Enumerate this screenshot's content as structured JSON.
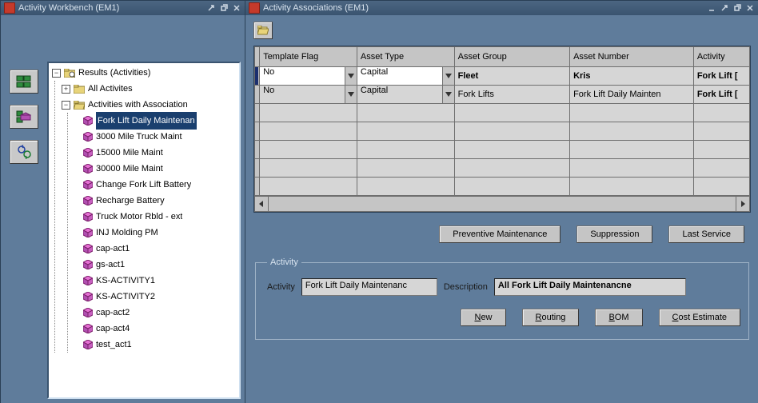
{
  "workbench": {
    "title": "Activity Workbench (EM1)",
    "tree_root": "Results (Activities)",
    "folder_all": "All Activites",
    "folder_assoc": "Activities with Association",
    "items": [
      "Fork Lift Daily Maintenan",
      "3000 Mile Truck Maint",
      "15000 Mile Maint",
      "30000 Mile Maint",
      "Change Fork Lift Battery",
      "Recharge Battery",
      "Truck Motor Rbld - ext",
      "INJ Molding PM",
      "cap-act1",
      "gs-act1",
      "KS-ACTIVITY1",
      "KS-ACTIVITY2",
      "cap-act2",
      "cap-act4",
      "test_act1"
    ]
  },
  "assoc": {
    "title": "Activity Associations (EM1)",
    "columns": [
      "Template Flag",
      "Asset Type",
      "Asset Group",
      "Asset Number",
      "Activity"
    ],
    "rows": [
      {
        "flag": "No",
        "type": "Capital",
        "group": "Fleet",
        "number": "Kris",
        "activity": "Fork Lift [",
        "current": true
      },
      {
        "flag": "No",
        "type": "Capital",
        "group": "Fork Lifts",
        "number": "Fork Lift Daily Mainten",
        "activity": "Fork Lift ["
      }
    ],
    "buttons_mid": [
      "Preventive Maintenance",
      "Suppression",
      "Last Service"
    ],
    "activity_legend": "Activity",
    "activity_label": "Activity",
    "activity_value": "Fork Lift Daily Maintenanc",
    "description_label": "Description",
    "description_value": "All Fork Lift Daily Maintenancne",
    "buttons_bot": [
      {
        "t": "New",
        "u": 0
      },
      {
        "t": "Routing",
        "u": 0
      },
      {
        "t": "BOM",
        "u": 0
      },
      {
        "t": "Cost Estimate",
        "u": 0
      }
    ]
  }
}
